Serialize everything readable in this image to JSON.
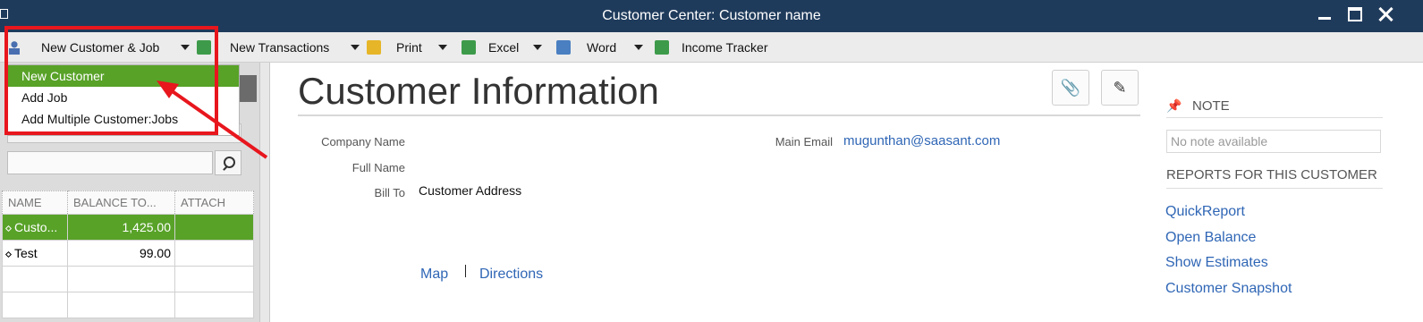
{
  "window": {
    "title": "Customer Center: Customer name"
  },
  "toolbar": {
    "new_customer_job": "New Customer & Job",
    "new_transactions": "New Transactions",
    "print": "Print",
    "excel": "Excel",
    "word": "Word",
    "income_tracker": "Income Tracker"
  },
  "dropdown": {
    "items": [
      "New Customer",
      "Add Job",
      "Add Multiple Customer:Jobs"
    ],
    "selected": "New Customer"
  },
  "customer_list": {
    "columns": [
      "NAME",
      "BALANCE TO...",
      "ATTACH"
    ],
    "rows": [
      {
        "name": "Custo...",
        "balance": "1,425.00",
        "attach": ""
      },
      {
        "name": "Test",
        "balance": "99.00",
        "attach": ""
      }
    ]
  },
  "customer_info": {
    "title": "Customer Information",
    "company_name_label": "Company Name",
    "full_name_label": "Full Name",
    "bill_to_label": "Bill To",
    "bill_to_value": "Customer Address",
    "main_email_label": "Main Email",
    "main_email_value": "mugunthan@saasant.com",
    "map_link": "Map",
    "directions_link": "Directions"
  },
  "note": {
    "header": "NOTE",
    "placeholder": "No note available"
  },
  "reports": {
    "header": "REPORTS FOR THIS CUSTOMER",
    "links": [
      "QuickReport",
      "Open Balance",
      "Show Estimates",
      "Customer Snapshot"
    ]
  },
  "colors": {
    "titlebar": "#1f3b5c",
    "selection_green": "#58a228",
    "highlight_red": "#e8161d",
    "link_blue": "#2f66b5"
  }
}
